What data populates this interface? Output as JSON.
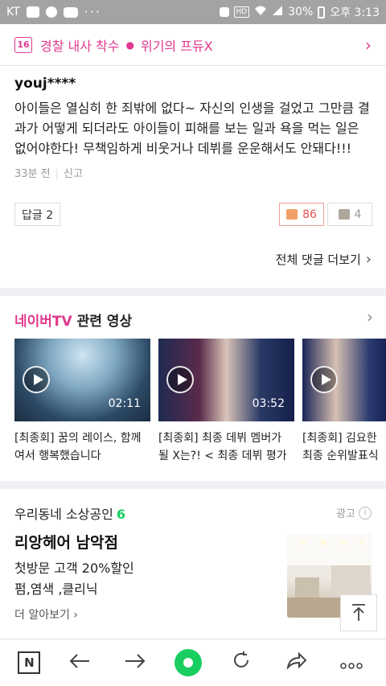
{
  "status_bar": {
    "carrier": "KT",
    "signal_extra": "HD",
    "battery": "30%",
    "time": "오후 3:13"
  },
  "topic_bar": {
    "number": "16",
    "title1": "경찰 내사 착수",
    "title2": "위기의 프듀X"
  },
  "comment": {
    "user": "youj****",
    "body": "아이들은 열심히 한 죄밖에 없다~ 자신의 인생을 걸었고 그만큼 결과가 어떻게 되더라도 아이들이 피해를 보는 일과 욕을 먹는 일은 없어야한다! 무책임하게 비웃거나 데뷔를 운운해서도 안돼다!!!",
    "time_ago": "33분 전",
    "report": "신고",
    "reply_label": "답글 2",
    "likes": "86",
    "dislikes": "4"
  },
  "more_comments": "전체 댓글 더보기",
  "naver_tv": {
    "brand": "네이버TV",
    "title": "관련 영상",
    "videos": [
      {
        "duration": "02:11",
        "title": "[최종회] 꿈의 레이스, 함께여서 행복했습니다"
      },
      {
        "duration": "03:52",
        "title": "[최종회] 최종 데뷔 멤버가 될 X는?! < 최종 데뷔 평가"
      },
      {
        "duration": "",
        "title": "[최종회] 김요한 최종 순위발표식"
      }
    ]
  },
  "ad": {
    "section_title": "우리동네 소상공인",
    "section_count": "6",
    "ad_label": "광고",
    "name": "리앙헤어 남악점",
    "desc1": "첫방문 고객 20%할인",
    "desc2": "펌,염색 ,클리닉",
    "more": "더 알아보기"
  },
  "nav": {
    "n_label": "N"
  }
}
